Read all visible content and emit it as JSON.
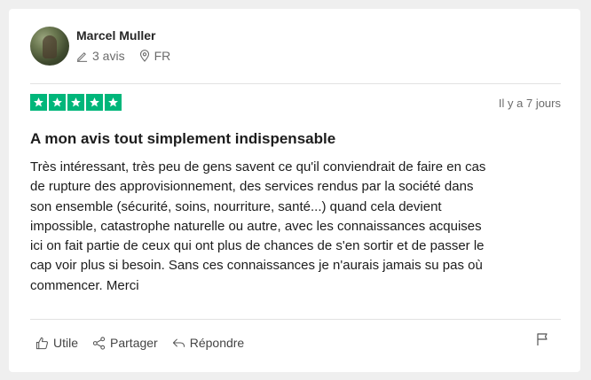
{
  "reviewer": {
    "name": "Marcel Muller",
    "reviews_count": "3 avis",
    "country": "FR"
  },
  "rating": {
    "stars": 5,
    "max_stars": 5,
    "color": "#00b67a"
  },
  "review": {
    "date": "Il y a 7 jours",
    "title": "A mon avis tout simplement indispensable",
    "lines": [
      "Très intéressant, très peu de gens savent ce qu'il conviendrait de faire en cas",
      "de rupture des approvisionnement, des services rendus par la société dans",
      "son ensemble (sécurité, soins, nourriture, santé...) quand cela devient",
      "impossible, catastrophe naturelle ou autre, avec les connaissances acquises",
      "ici on fait partie de ceux qui ont plus de chances de s'en sortir et de passer le",
      "cap voir plus si besoin. Sans ces connaissances je n'aurais jamais su pas où",
      "commencer. Merci"
    ]
  },
  "actions": {
    "useful_label": "Utile",
    "share_label": "Partager",
    "reply_label": "Répondre"
  },
  "icons": {
    "pencil": "pencil-icon",
    "location": "location-pin-icon",
    "thumb": "thumbs-up-icon",
    "share": "share-icon",
    "reply": "reply-icon",
    "flag": "flag-icon"
  }
}
